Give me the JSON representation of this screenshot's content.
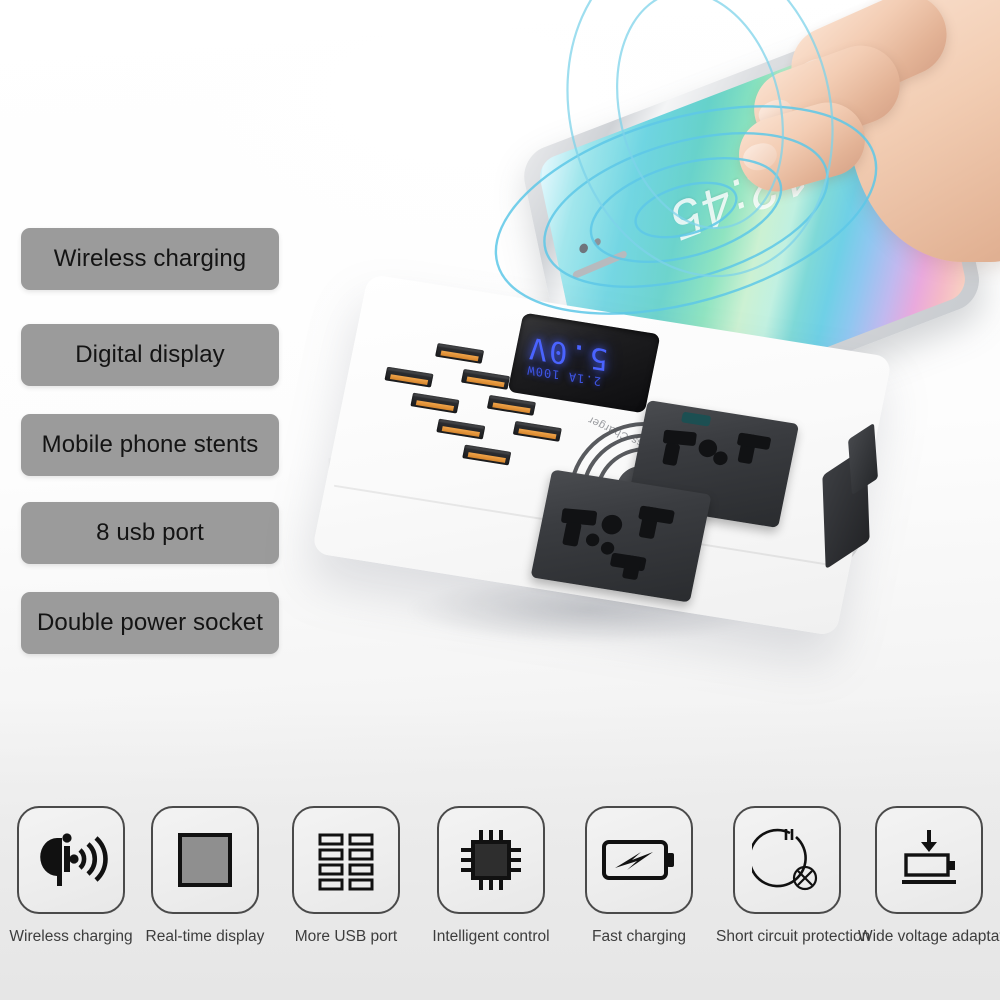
{
  "features": [
    {
      "label": "Wireless charging"
    },
    {
      "label": "Digital display"
    },
    {
      "label": "Mobile phone stents"
    },
    {
      "label": "8 usb port"
    },
    {
      "label": "Double power socket"
    }
  ],
  "product": {
    "brand_print": "Wireless Charger",
    "led_display": {
      "value": "5.0V",
      "sub": "2.1A 100W"
    },
    "phone": {
      "clock": "12:45"
    }
  },
  "icon_strip": [
    {
      "icon": "qi-wireless-icon",
      "label": "Wireless charging"
    },
    {
      "icon": "display-square-icon",
      "label": "Real-time display"
    },
    {
      "icon": "usb-ports-grid-icon",
      "label": "More USB port"
    },
    {
      "icon": "chip-cpu-icon",
      "label": "Intelligent control"
    },
    {
      "icon": "battery-bolt-icon",
      "label": "Fast charging"
    },
    {
      "icon": "short-circuit-icon",
      "label": "Short circuit protection"
    },
    {
      "icon": "wide-voltage-icon",
      "label": "Wide voltage adaptation"
    }
  ],
  "colors": {
    "pill_bg": "#9b9b9b",
    "pill_text": "#141414",
    "icon_outline": "#4a4a4a",
    "caption_text": "#3d3d3d",
    "led_blue": "#4a63ff",
    "wave_cyan": "#5ec8e8",
    "usb_contact": "#e0912f",
    "background_top": "#ffffff",
    "background_bottom": "#e9e9e9"
  }
}
